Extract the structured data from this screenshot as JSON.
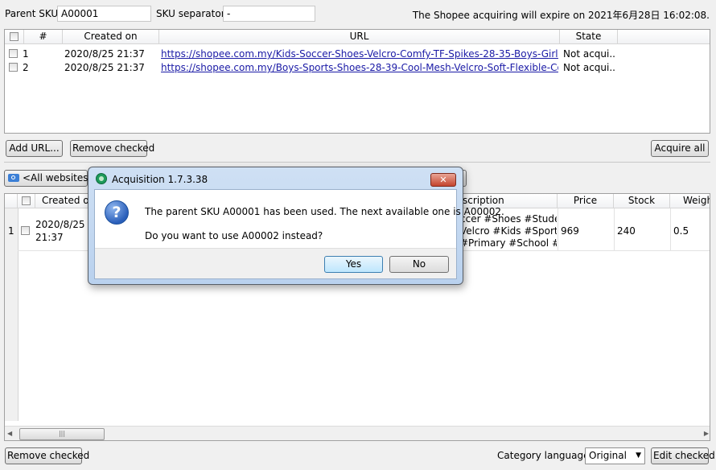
{
  "top": {
    "parent_sku_label": "Parent SKU:",
    "parent_sku_value": "A00001",
    "sku_separator_label": "SKU separator:",
    "sku_separator_value": "-",
    "expire_notice": "The Shopee acquiring will expire on 2021年6月28日 16:02:08."
  },
  "url_table": {
    "columns": [
      "#",
      "Created on",
      "URL",
      "State"
    ],
    "rows": [
      {
        "num": "1",
        "created": "2020/8/25 21:37",
        "url": "https://shopee.com.my/Kids-Soccer-Shoes-Velcro-Comfy-TF-Spikes-28-35-Boys-Girls-Spor...",
        "state": "Not acqui..."
      },
      {
        "num": "2",
        "created": "2020/8/25 21:37",
        "url": "https://shopee.com.my/Boys-Sports-Shoes-28-39-Cool-Mesh-Velcro-Soft-Flexible-Cosy-H...",
        "state": "Not acqui..."
      }
    ]
  },
  "actions": {
    "add_url": "Add URL...",
    "remove_checked": "Remove checked",
    "acquire_all": "Acquire all"
  },
  "filter": {
    "websites": "<All websites>"
  },
  "product_table": {
    "columns": [
      "Created on",
      "scription",
      "Price",
      "Stock",
      "Weigh"
    ],
    "rows": [
      {
        "num": "1",
        "created_line1": "2020/8/25",
        "created_line2": "21:37",
        "desc_line1": "ccer #Shoes #Student",
        "desc_line2": "Velcro #Kids #Sports",
        "desc_line3": "#Primary #School #...",
        "price": "969",
        "stock": "240",
        "weight": "0.5"
      }
    ],
    "scroll_thumb": "|||"
  },
  "bottom": {
    "remove_checked": "Remove checked",
    "category_language_label": "Category language:",
    "category_language_value": "Original",
    "edit_checked": "Edit checked"
  },
  "dialog": {
    "title": "Acquisition 1.7.3.38",
    "message1": "The parent SKU A00001 has been used. The next available one is A00002.",
    "message2": "Do you want to use A00002 instead?",
    "yes": "Yes",
    "no": "No",
    "close": "✕",
    "question_glyph": "?"
  }
}
